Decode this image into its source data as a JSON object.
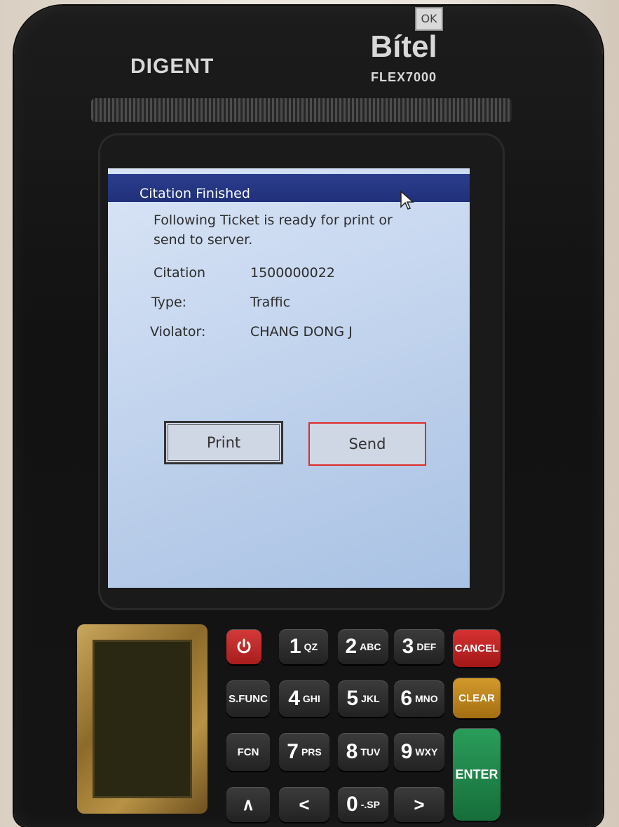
{
  "device": {
    "brand_left": "DIGENT",
    "brand_right": "Bítel",
    "model": "FLEX7000"
  },
  "dialog": {
    "title": "Citation Finished",
    "ok_label": "OK",
    "message_line1": "Following Ticket is ready for print or",
    "message_line2": "send to server.",
    "fields": [
      {
        "label": "Citation",
        "value": "1500000022"
      },
      {
        "label": "Type:",
        "value": "Traffic"
      },
      {
        "label": "Violator:",
        "value": "CHANG DONG J"
      }
    ],
    "print_label": "Print",
    "send_label": "Send"
  },
  "keypad": {
    "power_icon": "power-icon",
    "keys": [
      {
        "num": "1",
        "sub": "QZ"
      },
      {
        "num": "2",
        "sub": "ABC"
      },
      {
        "num": "3",
        "sub": "DEF"
      },
      {
        "num": "4",
        "sub": "GHI"
      },
      {
        "num": "5",
        "sub": "JKL"
      },
      {
        "num": "6",
        "sub": "MNO"
      },
      {
        "num": "7",
        "sub": "PRS"
      },
      {
        "num": "8",
        "sub": "TUV"
      },
      {
        "num": "9",
        "sub": "WXY"
      },
      {
        "num": "0",
        "sub": "-.SP"
      }
    ],
    "cancel": "CANCEL",
    "clear": "CLEAR",
    "enter": "ENTER",
    "sfunc": "S.FUNC",
    "fcn": "FCN",
    "up": "∧",
    "left": "<",
    "right": ">"
  },
  "colors": {
    "titlebar": "#20307a",
    "send_highlight": "#e02a2a",
    "cancel_key": "#c62828",
    "clear_key": "#c8891f",
    "enter_key": "#1f8a4c"
  }
}
